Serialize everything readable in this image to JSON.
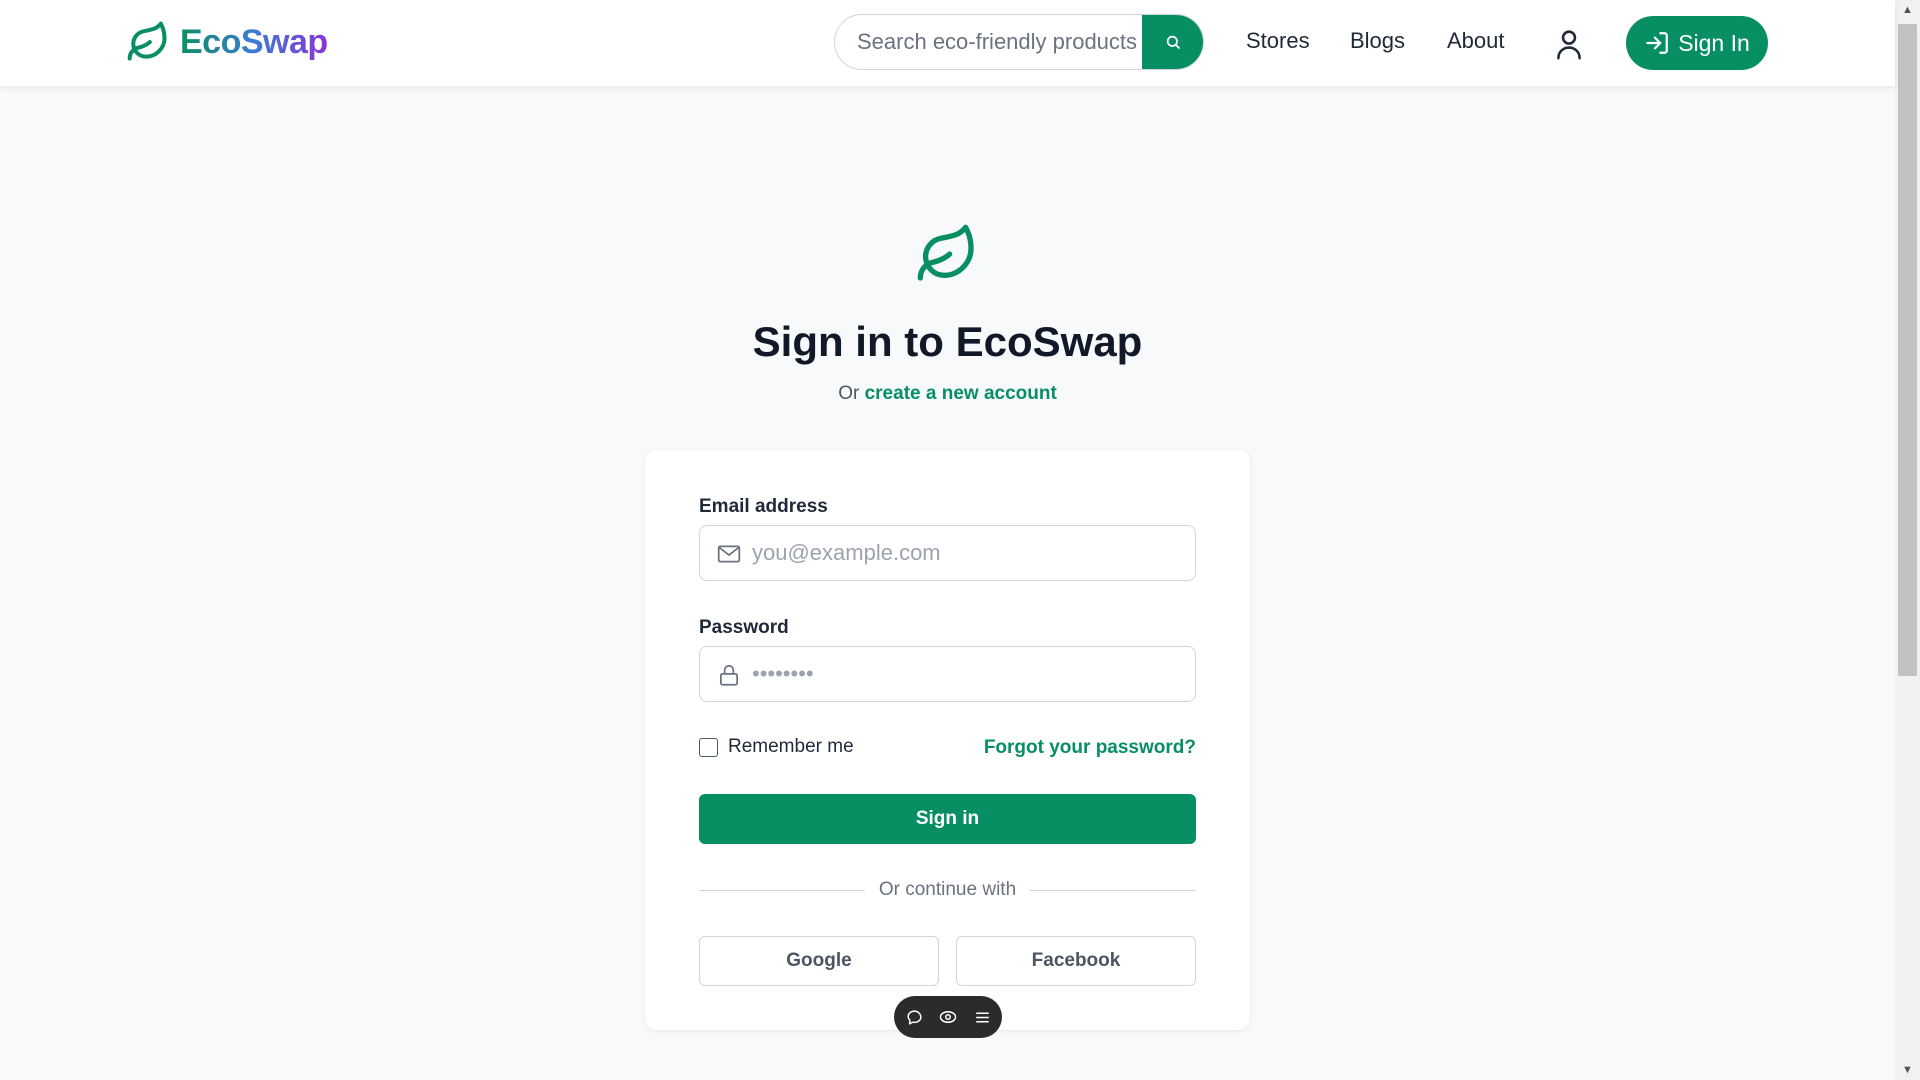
{
  "header": {
    "brand": "EcoSwap",
    "search_placeholder": "Search eco-friendly products",
    "nav": [
      "Stores",
      "Blogs",
      "About"
    ],
    "signin_label": "Sign In"
  },
  "main": {
    "title": "Sign in to EcoSwap",
    "subtitle_prefix": "Or",
    "create_account_link": "create a new account"
  },
  "form": {
    "email_label": "Email address",
    "email_placeholder": "you@example.com",
    "password_label": "Password",
    "password_placeholder": "••••••••",
    "remember_label": "Remember me",
    "forgot_link": "Forgot your password?",
    "submit_label": "Sign in",
    "divider_text": "Or continue with",
    "google_label": "Google",
    "facebook_label": "Facebook"
  },
  "colors": {
    "brand_green": "#078f63",
    "brand_gradient_end": "#8b34d9"
  },
  "icons": {
    "logo": "leaf-icon",
    "search": "search-icon",
    "user": "user-icon",
    "signin": "login-icon",
    "email": "mail-icon",
    "password": "lock-icon",
    "pill": [
      "chat-icon",
      "eye-icon",
      "menu-icon"
    ]
  }
}
